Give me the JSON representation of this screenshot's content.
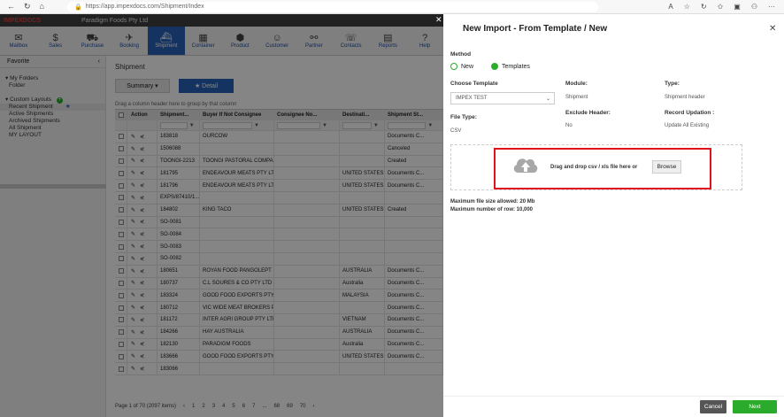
{
  "browser": {
    "url": "https://app.impexdocs.com/Shipment/Index"
  },
  "app": {
    "logo": "IMPEXDOCS",
    "company": "Paradigm Foods Pty Ltd",
    "modules": [
      {
        "label": "Mailbox",
        "icon": "mailbox-icon",
        "glyph": "✉"
      },
      {
        "label": "Sales",
        "icon": "dollar-icon",
        "glyph": "$"
      },
      {
        "label": "Purchase",
        "icon": "cart-icon",
        "glyph": "⛟"
      },
      {
        "label": "Booking",
        "icon": "plane-icon",
        "glyph": "✈"
      },
      {
        "label": "Shipment",
        "icon": "ship-icon",
        "glyph": "⛴"
      },
      {
        "label": "Container",
        "icon": "container-icon",
        "glyph": "▦"
      },
      {
        "label": "Product",
        "icon": "product-icon",
        "glyph": "⬢"
      },
      {
        "label": "Customer",
        "icon": "customer-icon",
        "glyph": "☺"
      },
      {
        "label": "Partner",
        "icon": "handshake-icon",
        "glyph": "⚯"
      },
      {
        "label": "Contacts",
        "icon": "phone-icon",
        "glyph": "☏"
      },
      {
        "label": "Reports",
        "icon": "report-icon",
        "glyph": "▤"
      },
      {
        "label": "Help",
        "icon": "help-icon",
        "glyph": "?"
      }
    ],
    "active_module": "Shipment"
  },
  "sidebar": {
    "favorite": "Favorite",
    "my_folders": "My Folders",
    "folder": "Folder",
    "custom_layouts": "Custom Layouts",
    "layouts": [
      "Recent Shipment",
      "Active Shipments",
      "Archived Shipments",
      "All Shipment",
      "MY LAYOUT"
    ]
  },
  "main": {
    "title": "Shipment",
    "tab_summary": "Summary ▾",
    "tab_detail": "★  Detail",
    "group_hint": "Drag a column header here to group by that column",
    "columns": [
      "Action",
      "Shipment...",
      "Buyer If Not Consignee",
      "Consignee No...",
      "Destinati...",
      "Shipment St..."
    ],
    "rows": [
      [
        "183818",
        "OURCOW",
        "",
        "",
        "Documents C..."
      ],
      [
        "1506088",
        "",
        "",
        "",
        "Canceled"
      ],
      [
        "TOONGI-2213",
        "TOONGI PASTORAL COMPAN...",
        "",
        "",
        "Created"
      ],
      [
        "181795",
        "ENDEAVOUR MEATS PTY LTD",
        "",
        "UNITED STATES",
        "Documents C..."
      ],
      [
        "181796",
        "ENDEAVOUR MEATS PTY LTD",
        "",
        "UNITED STATES",
        "Documents C..."
      ],
      [
        "EXPS/87410/1...",
        "",
        "",
        "",
        ""
      ],
      [
        "184802",
        "KING TACO",
        "",
        "UNITED STATES",
        "Created"
      ],
      [
        "SO-0081",
        "",
        "",
        "",
        ""
      ],
      [
        "SO-0084",
        "",
        "",
        "",
        ""
      ],
      [
        "SO-0083",
        "",
        "",
        "",
        ""
      ],
      [
        "SO-0082",
        "",
        "",
        "",
        ""
      ],
      [
        "180651",
        "ROYAN FOOD PANGOLEPT",
        "",
        "AUSTRALIA",
        "Documents C..."
      ],
      [
        "180737",
        "C.L SOURES & CO PTY LTD",
        "",
        "Australia",
        "Documents C..."
      ],
      [
        "183324",
        "GOOD FOOD EXPORTS PTY ...",
        "",
        "MALAYSIA",
        "Documents C..."
      ],
      [
        "180712",
        "VIC WIDE MEAT BROKERS PT...",
        "",
        "",
        "Documents C..."
      ],
      [
        "181172",
        "INTER AGRI GROUP PTY LTD",
        "",
        "VIETNAM",
        "Documents C..."
      ],
      [
        "184266",
        "HAY AUSTRALIA",
        "",
        "AUSTRALIA",
        "Documents C..."
      ],
      [
        "182130",
        "PARADIGM FOODS",
        "",
        "Australia",
        "Documents C..."
      ],
      [
        "183666",
        "GOOD FOOD EXPORTS PTY ...",
        "",
        "UNITED STATES",
        "Documents C..."
      ],
      [
        "183066",
        "",
        "",
        "",
        ""
      ]
    ],
    "pager": [
      "Page 1 of 70 (2097 items)",
      "‹",
      "1",
      "2",
      "3",
      "4",
      "5",
      "6",
      "7",
      "...",
      "68",
      "69",
      "70",
      "›"
    ]
  },
  "panel": {
    "title": "New Import - From Template / New",
    "method_label": "Method",
    "method_new": "New",
    "method_templates": "Templates",
    "method_selected": "Templates",
    "choose_template_label": "Choose Template",
    "choose_template_value": "IMPEX TEST",
    "module_label": "Module:",
    "module_value": "Shipment",
    "type_label": "Type:",
    "type_value": "Shipment header",
    "file_type_label": "File Type:",
    "file_type_value": "CSV",
    "exclude_header_label": "Exclude Header:",
    "exclude_header_value": "No",
    "record_updation_label": "Record Updation :",
    "record_updation_value": "Update All Existing",
    "drop_text": "Drag and drop csv / xls file here or",
    "browse": "Browse",
    "max_file_size": "Maximum file size allowed: 20 Mb",
    "max_rows": "Maximum number of row: 10,000",
    "cancel": "Cancel",
    "next": "Next"
  },
  "colors": {
    "accent_blue": "#2a62b8",
    "accent_green": "#2bab2b",
    "highlight_red": "#e0121e"
  }
}
